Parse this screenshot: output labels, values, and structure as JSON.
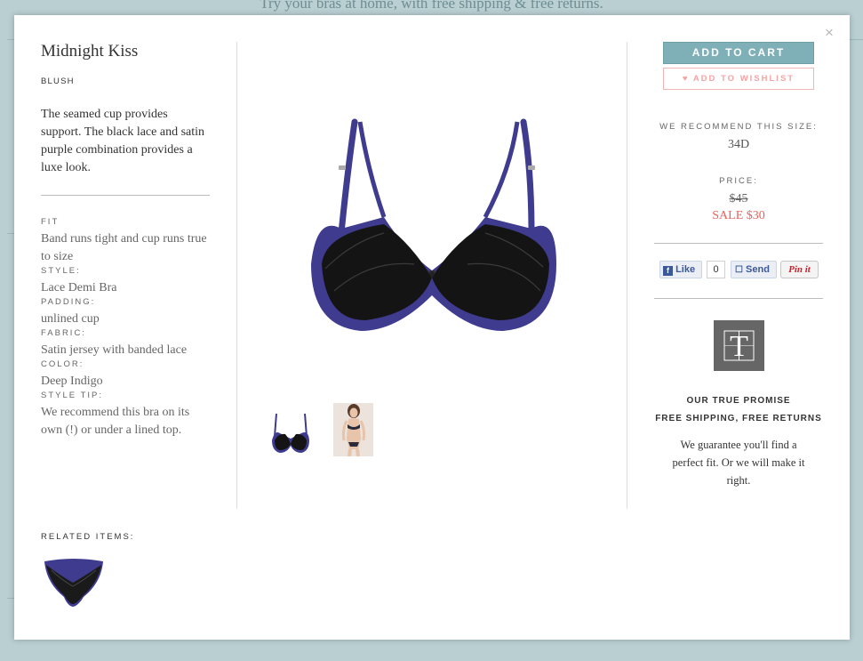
{
  "background": {
    "banner": "Try your bras at home, with free shipping & free returns."
  },
  "product": {
    "name": "Midnight Kiss",
    "color_name": "BLUSH",
    "description": "The seamed cup provides support. The black lace and satin purple combination provides a luxe look.",
    "specs": [
      {
        "label": "FIT",
        "value": "Band runs tight and cup runs true to size"
      },
      {
        "label": "STYLE:",
        "value": "Lace Demi Bra"
      },
      {
        "label": "PADDING:",
        "value": "unlined cup"
      },
      {
        "label": "FABRIC:",
        "value": "Satin jersey with banded lace"
      },
      {
        "label": "COLOR:",
        "value": "Deep Indigo"
      },
      {
        "label": "STYLE TIP:",
        "value": "We recommend this bra on its own (!) or under a lined top."
      }
    ],
    "related_label": "RELATED ITEMS:"
  },
  "actions": {
    "add_to_cart": "ADD TO CART",
    "add_to_wishlist": "♥ ADD TO WISHLIST",
    "close": "×"
  },
  "sizing": {
    "label": "WE RECOMMEND THIS SIZE:",
    "size": "34D"
  },
  "pricing": {
    "label": "PRICE:",
    "original": "$45",
    "sale": "SALE $30"
  },
  "social": {
    "like": "Like",
    "like_count": "0",
    "send": "Send",
    "pin": "Pin it"
  },
  "promise": {
    "logo_letter": "T",
    "title": "OUR TRUE PROMISE",
    "subtitle": "FREE SHIPPING, FREE RETURNS",
    "text": "We guarantee you'll find a perfect fit. Or we will make it right."
  },
  "colors": {
    "accent": "#7fb0b7",
    "sale": "#e8625c",
    "wishlist": "#f5a3a3",
    "bra_satin": "#3f3b8f",
    "lace": "#141414"
  }
}
